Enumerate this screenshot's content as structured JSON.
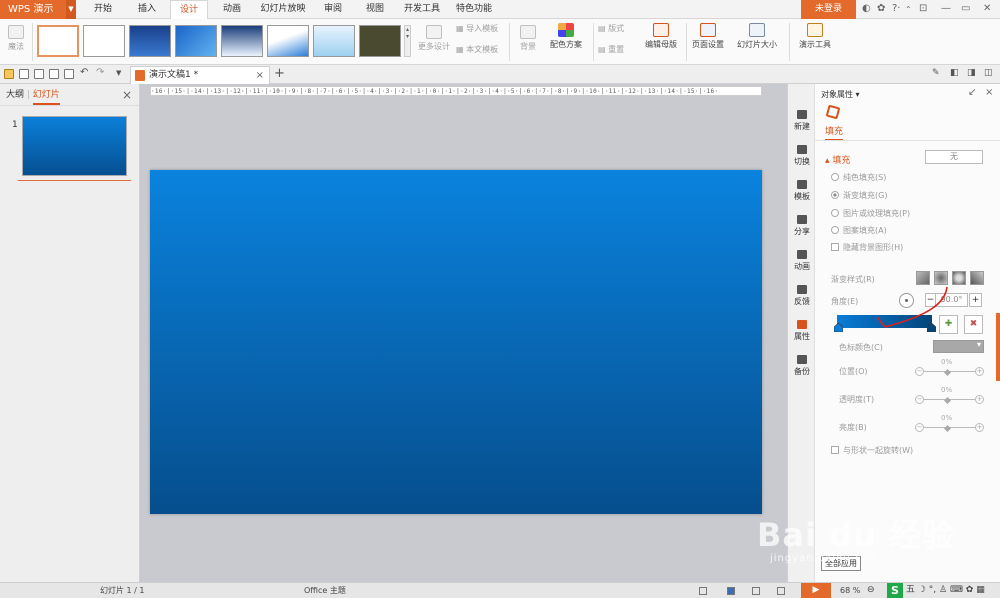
{
  "app": {
    "name": "WPS 演示",
    "login": "未登录"
  },
  "menu": {
    "tabs": [
      {
        "label": "开始"
      },
      {
        "label": "插入"
      },
      {
        "label": "设计"
      },
      {
        "label": "动画"
      },
      {
        "label": "幻灯片放映"
      },
      {
        "label": "审阅"
      },
      {
        "label": "视图"
      },
      {
        "label": "开发工具"
      },
      {
        "label": "特色功能"
      }
    ],
    "active_tab": "设计"
  },
  "ribbon": {
    "magic": "魔法",
    "more_design": "更多设计",
    "import_template": "导入模板",
    "this_template": "本文模板",
    "background": "背景",
    "color_scheme": "配色方案",
    "layout": "版式",
    "reset": "重置",
    "edit_master": "编辑母版",
    "page_setup": "页面设置",
    "slide_size": "幻灯片大小",
    "present_tools": "演示工具"
  },
  "document": {
    "tab_title": "演示文稿1 *"
  },
  "left_panel": {
    "outline": "大纲",
    "slides": "幻灯片",
    "slide_number": "1"
  },
  "ruler": {
    "text": "·16·|·15·|·14·|·13·|·12·|·11·|·10·|·9·|·8·|·7·|·6·|·5·|·4·|·3·|·2·|·1·|·0·|·1·|·2·|·3·|·4·|·5·|·6·|·7·|·8·|·9·|·10·|·11·|·12·|·13·|·14·|·15·|·16·"
  },
  "side_strip": {
    "items": [
      {
        "label": "新建"
      },
      {
        "label": "切换"
      },
      {
        "label": "模板"
      },
      {
        "label": "分享"
      },
      {
        "label": "动画"
      },
      {
        "label": "反馈"
      },
      {
        "label": "属性"
      },
      {
        "label": "备份"
      }
    ]
  },
  "properties": {
    "title": "对象属性 ▾",
    "fill_tab": "填充",
    "fill_section": "填充",
    "none_button": "无",
    "options": {
      "solid": "纯色填充(S)",
      "gradient": "渐变填充(G)",
      "picture": "图片或纹理填充(P)",
      "pattern": "图案填充(A)",
      "hide_bg": "隐藏背景图形(H)"
    },
    "gradient_style": "渐变样式(R)",
    "angle_label": "角度(E)",
    "angle_value": "90.0°",
    "stop_color": "色标颜色(C)",
    "position": "位置(O)",
    "transparency": "透明度(T)",
    "brightness": "亮度(B)",
    "slider_value": "0%",
    "rotate_with_shape": "与形状一起旋转(W)",
    "apply_all": "全部应用"
  },
  "status": {
    "slide": "幻灯片 1 / 1",
    "theme": "Office 主题",
    "zoom": "68 %"
  },
  "watermark": {
    "brand": "Bai du 经验",
    "url": "jingyan.baidu.com"
  }
}
